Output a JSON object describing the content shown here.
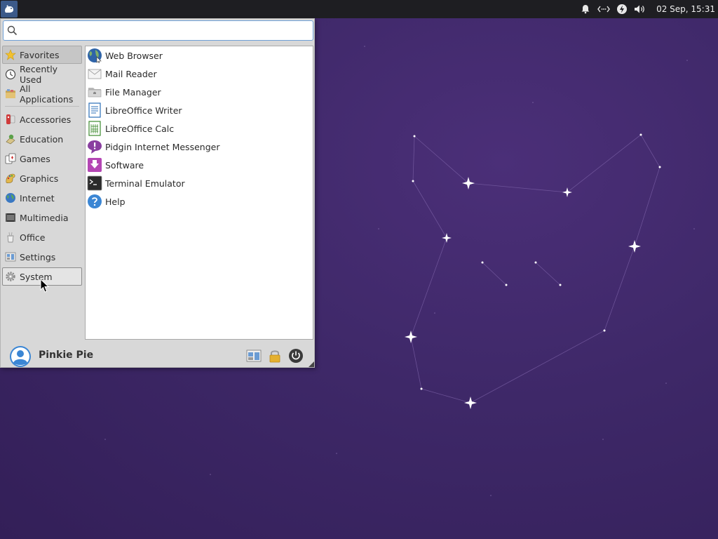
{
  "panel": {
    "clock": "02 Sep, 15:31",
    "tray_icons": [
      "notification-bell-icon",
      "network-icon",
      "power-manager-icon",
      "volume-icon"
    ]
  },
  "menu": {
    "search": {
      "value": "",
      "placeholder": ""
    },
    "categories": [
      {
        "label": "Favorites",
        "icon": "star-icon",
        "state": "selected"
      },
      {
        "label": "Recently Used",
        "icon": "clock-icon"
      },
      {
        "label": "All Applications",
        "icon": "folder-icon"
      },
      {
        "label": "Accessories",
        "icon": "accessories-icon"
      },
      {
        "label": "Education",
        "icon": "education-icon"
      },
      {
        "label": "Games",
        "icon": "games-icon"
      },
      {
        "label": "Graphics",
        "icon": "graphics-icon"
      },
      {
        "label": "Internet",
        "icon": "globe-icon"
      },
      {
        "label": "Multimedia",
        "icon": "multimedia-icon"
      },
      {
        "label": "Office",
        "icon": "office-icon"
      },
      {
        "label": "Settings",
        "icon": "settings-icon"
      },
      {
        "label": "System",
        "icon": "gear-icon",
        "state": "hover"
      }
    ],
    "apps": [
      {
        "label": "Web Browser",
        "icon": "web-browser-icon"
      },
      {
        "label": "Mail Reader",
        "icon": "mail-icon"
      },
      {
        "label": "File Manager",
        "icon": "file-manager-icon"
      },
      {
        "label": "LibreOffice Writer",
        "icon": "writer-icon"
      },
      {
        "label": "LibreOffice Calc",
        "icon": "calc-icon"
      },
      {
        "label": "Pidgin Internet Messenger",
        "icon": "pidgin-icon"
      },
      {
        "label": "Software",
        "icon": "software-icon"
      },
      {
        "label": "Terminal Emulator",
        "icon": "terminal-icon"
      },
      {
        "label": "Help",
        "icon": "help-icon"
      }
    ],
    "user": {
      "name": "Pinkie Pie"
    },
    "footer_buttons": [
      "settings-manager-icon",
      "lock-icon",
      "power-icon"
    ]
  },
  "colors": {
    "desktop": "#3e2868",
    "panel": "#1e1e22",
    "menu": "#d8d8d8",
    "search_border": "#6fa0d6"
  }
}
